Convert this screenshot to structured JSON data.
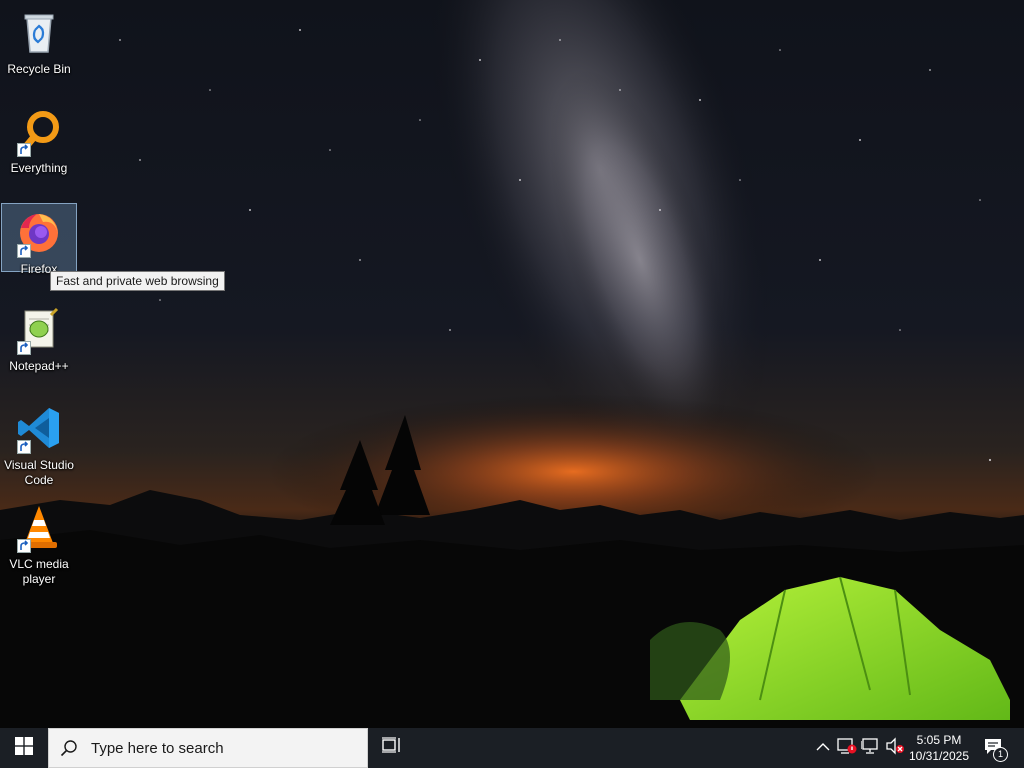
{
  "desktop": {
    "icons": [
      {
        "label": "Recycle Bin",
        "icon": "recycle-bin-icon",
        "shortcut": false
      },
      {
        "label": "Everything",
        "icon": "everything-search-icon",
        "shortcut": true
      },
      {
        "label": "Firefox",
        "icon": "firefox-icon",
        "shortcut": true,
        "selected": true
      },
      {
        "label": "Notepad++",
        "icon": "notepad-plus-plus-icon",
        "shortcut": true
      },
      {
        "label": "Visual Studio Code",
        "icon": "vscode-icon",
        "shortcut": true
      },
      {
        "label": "VLC media player",
        "icon": "vlc-icon",
        "shortcut": true
      }
    ],
    "tooltip": "Fast and private web browsing"
  },
  "taskbar": {
    "start_icon": "windows-logo-icon",
    "search_placeholder": "Type here to search",
    "task_view_icon": "task-view-icon",
    "tray": {
      "icons": [
        "chevron-up-icon",
        "security-alert-icon",
        "network-disconnected-icon",
        "volume-muted-icon"
      ],
      "time": "5:05 PM",
      "date": "10/31/2025",
      "notification_icon": "action-center-icon",
      "notification_count": "1"
    }
  },
  "colors": {
    "taskbar": "#1b1f25",
    "search_box": "#f3f3f3",
    "selection": "#78a0c8",
    "tent_green": "#9be22b",
    "horizon_glow": "#e8641c"
  }
}
